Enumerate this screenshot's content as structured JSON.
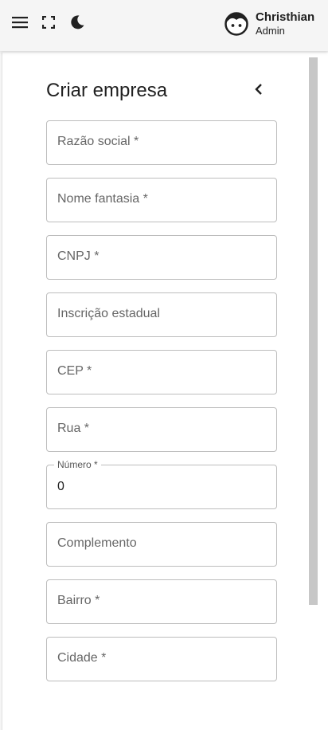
{
  "header": {
    "user_name": "Christhian",
    "user_role": "Admin"
  },
  "form": {
    "title": "Criar empresa",
    "fields": [
      {
        "label": "Razão social *",
        "value": ""
      },
      {
        "label": "Nome fantasia *",
        "value": ""
      },
      {
        "label": "CNPJ *",
        "value": ""
      },
      {
        "label": "Inscrição estadual",
        "value": ""
      },
      {
        "label": "CEP *",
        "value": ""
      },
      {
        "label": "Rua *",
        "value": ""
      },
      {
        "label": "Número *",
        "value": "0"
      },
      {
        "label": "Complemento",
        "value": ""
      },
      {
        "label": "Bairro *",
        "value": ""
      },
      {
        "label": "Cidade *",
        "value": ""
      }
    ]
  }
}
